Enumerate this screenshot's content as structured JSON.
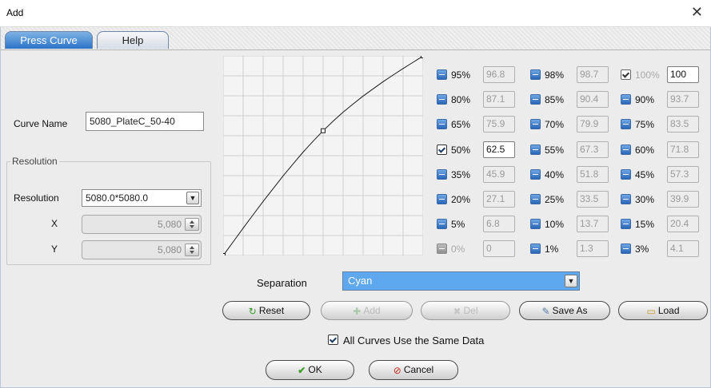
{
  "window": {
    "title": "Add"
  },
  "tabs": [
    {
      "label": "Press Curve"
    },
    {
      "label": "Help"
    }
  ],
  "curve_name": {
    "label": "Curve Name",
    "value": "5080_PlateC_50-40"
  },
  "resolution": {
    "group_title": "Resolution",
    "label": "Resolution",
    "value": "5080.0*5080.0",
    "x_label": "X",
    "x_value": "5,080",
    "y_label": "Y",
    "y_value": "5,080"
  },
  "chart_data": {
    "type": "line",
    "title": "",
    "xlabel": "",
    "ylabel": "",
    "xlim": [
      0,
      100
    ],
    "ylim": [
      0,
      100
    ],
    "grid": true,
    "x": [
      0,
      1,
      3,
      5,
      10,
      15,
      20,
      25,
      30,
      35,
      40,
      45,
      50,
      55,
      60,
      65,
      70,
      75,
      80,
      85,
      90,
      95,
      98,
      100
    ],
    "y": [
      0,
      1.3,
      4.1,
      6.8,
      13.7,
      20.4,
      27.1,
      33.5,
      39.9,
      45.9,
      51.8,
      57.3,
      62.5,
      67.3,
      71.8,
      75.9,
      79.9,
      83.5,
      87.1,
      90.4,
      93.7,
      96.8,
      98.7,
      100
    ],
    "control_points": [
      [
        0,
        0
      ],
      [
        50,
        62.5
      ],
      [
        100,
        100
      ]
    ]
  },
  "points": [
    {
      "pct": "95%",
      "value": "96.8",
      "checked": false,
      "enabled": true
    },
    {
      "pct": "98%",
      "value": "98.7",
      "checked": false,
      "enabled": true
    },
    {
      "pct": "100%",
      "value": "100",
      "checked": true,
      "enabled": false
    },
    {
      "pct": "80%",
      "value": "87.1",
      "checked": false,
      "enabled": true
    },
    {
      "pct": "85%",
      "value": "90.4",
      "checked": false,
      "enabled": true
    },
    {
      "pct": "90%",
      "value": "93.7",
      "checked": false,
      "enabled": true
    },
    {
      "pct": "65%",
      "value": "75.9",
      "checked": false,
      "enabled": true
    },
    {
      "pct": "70%",
      "value": "79.9",
      "checked": false,
      "enabled": true
    },
    {
      "pct": "75%",
      "value": "83.5",
      "checked": false,
      "enabled": true
    },
    {
      "pct": "50%",
      "value": "62.5",
      "checked": true,
      "enabled": true
    },
    {
      "pct": "55%",
      "value": "67.3",
      "checked": false,
      "enabled": true
    },
    {
      "pct": "60%",
      "value": "71.8",
      "checked": false,
      "enabled": true
    },
    {
      "pct": "35%",
      "value": "45.9",
      "checked": false,
      "enabled": true
    },
    {
      "pct": "40%",
      "value": "51.8",
      "checked": false,
      "enabled": true
    },
    {
      "pct": "45%",
      "value": "57.3",
      "checked": false,
      "enabled": true
    },
    {
      "pct": "20%",
      "value": "27.1",
      "checked": false,
      "enabled": true
    },
    {
      "pct": "25%",
      "value": "33.5",
      "checked": false,
      "enabled": true
    },
    {
      "pct": "30%",
      "value": "39.9",
      "checked": false,
      "enabled": true
    },
    {
      "pct": "5%",
      "value": "6.8",
      "checked": false,
      "enabled": true
    },
    {
      "pct": "10%",
      "value": "13.7",
      "checked": false,
      "enabled": true
    },
    {
      "pct": "15%",
      "value": "20.4",
      "checked": false,
      "enabled": true
    },
    {
      "pct": "0%",
      "value": "0",
      "checked": false,
      "enabled": false
    },
    {
      "pct": "1%",
      "value": "1.3",
      "checked": false,
      "enabled": true
    },
    {
      "pct": "3%",
      "value": "4.1",
      "checked": false,
      "enabled": true
    }
  ],
  "separation": {
    "label": "Separation",
    "value": "Cyan"
  },
  "buttons": {
    "reset": "Reset",
    "add": "Add",
    "del": "Del",
    "save_as": "Save As",
    "load": "Load",
    "ok": "OK",
    "cancel": "Cancel"
  },
  "all_curves": {
    "label": "All Curves Use the Same Data",
    "checked": true
  },
  "icons": {
    "close": "close-icon",
    "reset": "reset-icon",
    "add": "plus-icon",
    "del": "x-icon",
    "save_as": "save-icon",
    "load": "folder-icon",
    "ok": "check-icon",
    "cancel": "cancel-icon"
  }
}
